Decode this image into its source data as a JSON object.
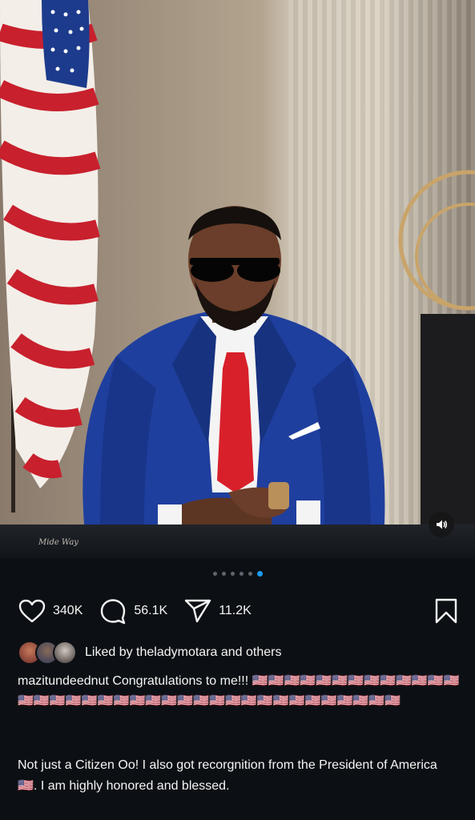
{
  "post": {
    "watermark": "Mide Way",
    "carousel": {
      "total": 6,
      "active_index": 5
    },
    "actions": {
      "likes": "340K",
      "comments": "56.1K",
      "shares": "11.2K"
    },
    "liked_by": "Liked by theladymotara and others",
    "caption": {
      "username": "mazitundeednut",
      "text": "Congratulations to me!!!",
      "flags": "🇺🇸🇺🇸🇺🇸🇺🇸🇺🇸🇺🇸🇺🇸🇺🇸🇺🇸🇺🇸🇺🇸🇺🇸🇺🇸🇺🇸🇺🇸🇺🇸🇺🇸🇺🇸🇺🇸🇺🇸🇺🇸🇺🇸🇺🇸🇺🇸🇺🇸🇺🇸🇺🇸🇺🇸🇺🇸🇺🇸🇺🇸🇺🇸🇺🇸🇺🇸🇺🇸🇺🇸🇺🇸",
      "paragraph_before_flag": "Not just a Citizen Oo! I also got recorgnition from the President of America",
      "paragraph_flag": "🇺🇸",
      "paragraph_after_flag": ". I am highly honored and blessed."
    }
  }
}
